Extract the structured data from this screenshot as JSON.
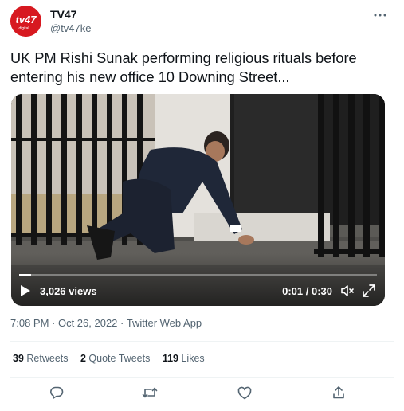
{
  "author": {
    "avatar_text": "tv47",
    "avatar_subtext": "digital",
    "display_name": "TV47",
    "handle": "@tv47ke"
  },
  "tweet": {
    "text": "UK PM Rishi Sunak performing religious rituals before entering his new office 10 Downing Street..."
  },
  "video": {
    "views": "3,026 views",
    "time": "0:01 / 0:30",
    "progress_percent": 3.33
  },
  "meta": {
    "timestamp": "7:08 PM · Oct 26, 2022 · ",
    "source_app": "Twitter Web App"
  },
  "stats": {
    "retweets_count": "39",
    "retweets_label": "Retweets",
    "quotes_count": "2",
    "quotes_label": "Quote Tweets",
    "likes_count": "119",
    "likes_label": "Likes"
  },
  "icons": {
    "more": "more-horizontal-icon",
    "play": "play-icon",
    "mute": "volume-muted-icon",
    "fullscreen": "fullscreen-icon",
    "reply": "reply-icon",
    "retweet": "retweet-icon",
    "like": "heart-icon",
    "share": "share-icon"
  },
  "colors": {
    "brand_red": "#d71920",
    "text_primary": "#0f1419",
    "text_secondary": "#536471"
  }
}
